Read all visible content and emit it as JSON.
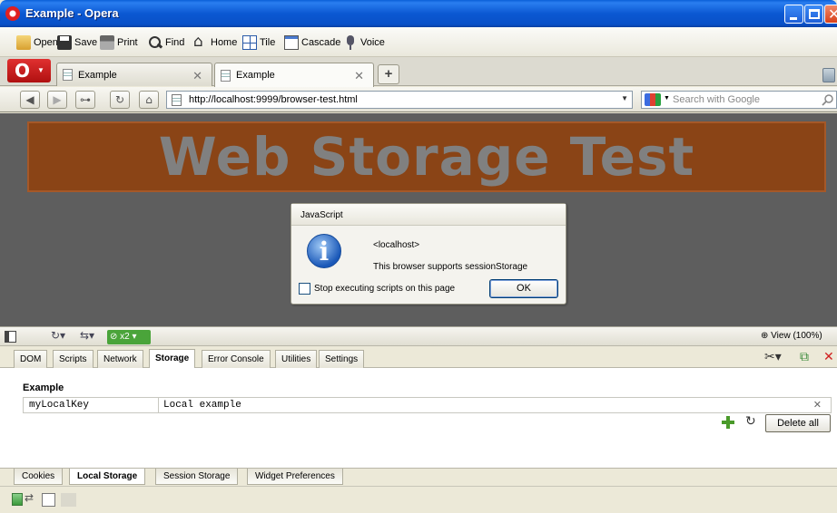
{
  "window": {
    "title": "Example - Opera"
  },
  "toolbar": {
    "items": [
      {
        "label": "Open",
        "icon": "folder-icon"
      },
      {
        "label": "Save",
        "icon": "floppy-icon"
      },
      {
        "label": "Print",
        "icon": "printer-icon"
      },
      {
        "label": "Find",
        "icon": "magnifier-icon"
      },
      {
        "label": "Home",
        "icon": "home-icon"
      },
      {
        "label": "Tile",
        "icon": "tile-icon"
      },
      {
        "label": "Cascade",
        "icon": "cascade-icon"
      },
      {
        "label": "Voice",
        "icon": "microphone-icon"
      }
    ]
  },
  "tabs": [
    {
      "label": "Example",
      "active": false
    },
    {
      "label": "Example",
      "active": true
    }
  ],
  "addressbar": {
    "url": "http://localhost:9999/browser-test.html",
    "search_placeholder": "Search with Google"
  },
  "page": {
    "heading": "Web Storage Test"
  },
  "dialog": {
    "title": "JavaScript",
    "host": "<localhost>",
    "message": "This browser supports sessionStorage",
    "checkbox_label": "Stop executing scripts on this page",
    "ok_label": "OK"
  },
  "devtools": {
    "badge": "x2",
    "view": "View (100%)",
    "tabs": [
      "DOM",
      "Scripts",
      "Network",
      "Storage",
      "Error Console",
      "Utilities",
      "Settings"
    ],
    "active_tab": "Storage",
    "storage": {
      "section_title": "Example",
      "rows": [
        {
          "key": "myLocalKey",
          "value": "Local example"
        }
      ],
      "delete_all_label": "Delete all",
      "subtabs": [
        "Cookies",
        "Local Storage",
        "Session Storage",
        "Widget Preferences"
      ],
      "active_subtab": "Local Storage"
    }
  },
  "colors": {
    "titlebar": "#0a5fd8",
    "banner": "#8a4416",
    "content_bg": "#5e5e5e"
  }
}
